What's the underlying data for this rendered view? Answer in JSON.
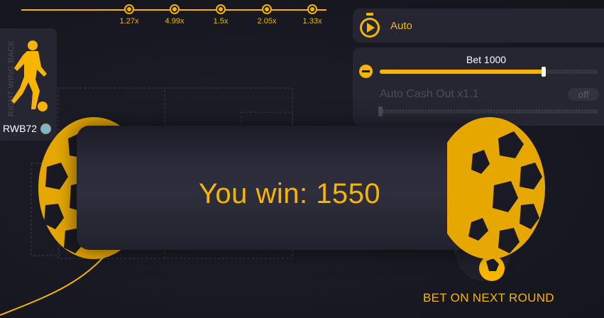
{
  "history": {
    "multipliers": [
      "1.27x",
      "4.99x",
      "1.5x",
      "2.05x",
      "1.33x"
    ]
  },
  "player": {
    "position": "RIGHT WING BACK",
    "name": "RWB72"
  },
  "auto": {
    "label": "Auto",
    "bet_label": "Bet 1000",
    "bet_fraction": 0.75,
    "cashout_label": "Auto Cash Out x1.1",
    "cashout_toggle": "off"
  },
  "result": {
    "text": "You win: 1550"
  },
  "next_round": {
    "label": "BET ON NEXT ROUND"
  },
  "colors": {
    "accent": "#f7b500",
    "panel": "#262632",
    "background": "#1a1a24"
  }
}
